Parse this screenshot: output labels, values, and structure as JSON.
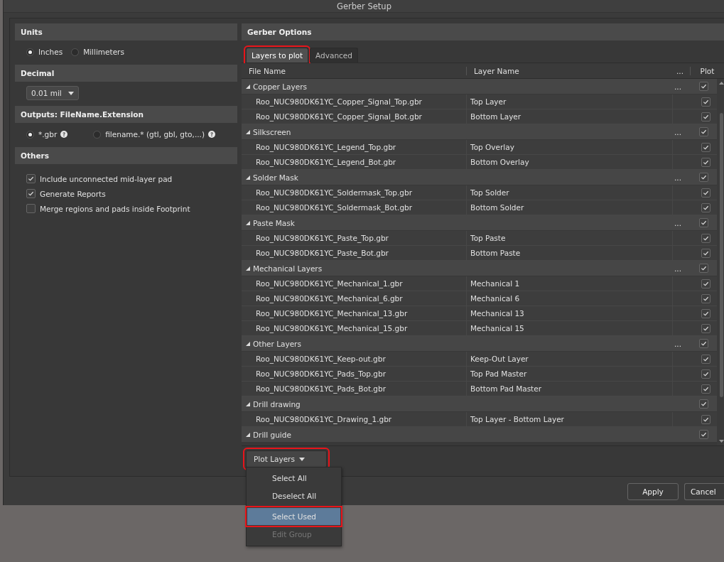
{
  "window": {
    "title": "Gerber Setup"
  },
  "units": {
    "heading": "Units",
    "options": [
      {
        "label": "Inches",
        "selected": true
      },
      {
        "label": "Millimeters",
        "selected": false
      }
    ]
  },
  "decimal": {
    "heading": "Decimal",
    "value": "0.01 mil"
  },
  "outputs": {
    "heading": "Outputs: FileName.Extension",
    "options": [
      {
        "label": "*.gbr",
        "selected": true
      },
      {
        "label": "filename.* (gtl, gbl, gto,...)",
        "selected": false
      }
    ]
  },
  "others": {
    "heading": "Others",
    "options": [
      {
        "label": "Include unconnected mid-layer pad",
        "checked": true
      },
      {
        "label": "Generate Reports",
        "checked": true
      },
      {
        "label": "Merge regions and pads inside Footprint",
        "checked": false
      }
    ]
  },
  "gerber_options": {
    "heading": "Gerber Options",
    "tabs": [
      {
        "label": "Layers to plot",
        "selected": true,
        "highlighted": true
      },
      {
        "label": "Advanced",
        "selected": false,
        "highlighted": false
      }
    ],
    "table": {
      "columns": [
        "File Name",
        "Layer Name",
        "...",
        "Plot"
      ],
      "groups": [
        {
          "name": "Copper Layers",
          "expanded": true,
          "more": "...",
          "plot": true,
          "rows": [
            {
              "file_name": "Roo_NUC980DK61YC_Copper_Signal_Top.gbr",
              "layer_name": "Top Layer",
              "plot": true
            },
            {
              "file_name": "Roo_NUC980DK61YC_Copper_Signal_Bot.gbr",
              "layer_name": "Bottom Layer",
              "plot": true
            }
          ]
        },
        {
          "name": "Silkscreen",
          "expanded": true,
          "more": "...",
          "plot": true,
          "rows": [
            {
              "file_name": "Roo_NUC980DK61YC_Legend_Top.gbr",
              "layer_name": "Top Overlay",
              "plot": true
            },
            {
              "file_name": "Roo_NUC980DK61YC_Legend_Bot.gbr",
              "layer_name": "Bottom Overlay",
              "plot": true
            }
          ]
        },
        {
          "name": "Solder Mask",
          "expanded": true,
          "more": "...",
          "plot": true,
          "rows": [
            {
              "file_name": "Roo_NUC980DK61YC_Soldermask_Top.gbr",
              "layer_name": "Top Solder",
              "plot": true
            },
            {
              "file_name": "Roo_NUC980DK61YC_Soldermask_Bot.gbr",
              "layer_name": "Bottom Solder",
              "plot": true
            }
          ]
        },
        {
          "name": "Paste Mask",
          "expanded": true,
          "more": "...",
          "plot": true,
          "rows": [
            {
              "file_name": "Roo_NUC980DK61YC_Paste_Top.gbr",
              "layer_name": "Top Paste",
              "plot": true
            },
            {
              "file_name": "Roo_NUC980DK61YC_Paste_Bot.gbr",
              "layer_name": "Bottom Paste",
              "plot": true
            }
          ]
        },
        {
          "name": "Mechanical Layers",
          "expanded": true,
          "more": "...",
          "plot": true,
          "rows": [
            {
              "file_name": "Roo_NUC980DK61YC_Mechanical_1.gbr",
              "layer_name": "Mechanical 1",
              "plot": true
            },
            {
              "file_name": "Roo_NUC980DK61YC_Mechanical_6.gbr",
              "layer_name": "Mechanical 6",
              "plot": true
            },
            {
              "file_name": "Roo_NUC980DK61YC_Mechanical_13.gbr",
              "layer_name": "Mechanical 13",
              "plot": true
            },
            {
              "file_name": "Roo_NUC980DK61YC_Mechanical_15.gbr",
              "layer_name": "Mechanical 15",
              "plot": true
            }
          ]
        },
        {
          "name": "Other Layers",
          "expanded": true,
          "more": "...",
          "plot": true,
          "rows": [
            {
              "file_name": "Roo_NUC980DK61YC_Keep-out.gbr",
              "layer_name": "Keep-Out Layer",
              "plot": true
            },
            {
              "file_name": "Roo_NUC980DK61YC_Pads_Top.gbr",
              "layer_name": "Top Pad Master",
              "plot": true
            },
            {
              "file_name": "Roo_NUC980DK61YC_Pads_Bot.gbr",
              "layer_name": "Bottom Pad Master",
              "plot": true
            }
          ]
        },
        {
          "name": "Drill drawing",
          "expanded": true,
          "plot": true,
          "rows": [
            {
              "file_name": "Roo_NUC980DK61YC_Drawing_1.gbr",
              "layer_name": "Top Layer - Bottom Layer",
              "plot": true
            }
          ]
        },
        {
          "name": "Drill guide",
          "expanded": true,
          "plot": true
        }
      ]
    },
    "plot_layers_button": {
      "label": "Plot Layers",
      "highlighted": true
    }
  },
  "plot_layers_menu": {
    "items": [
      {
        "label": "Select All",
        "selected": false,
        "disabled": false,
        "highlighted": false
      },
      {
        "label": "Deselect All",
        "selected": false,
        "disabled": false,
        "highlighted": false
      },
      {
        "label": "Select Used",
        "selected": true,
        "disabled": false,
        "highlighted": true
      },
      {
        "label": "Edit Group",
        "selected": false,
        "disabled": true,
        "highlighted": false
      }
    ]
  },
  "buttons": [
    "Apply",
    "Cancel"
  ]
}
